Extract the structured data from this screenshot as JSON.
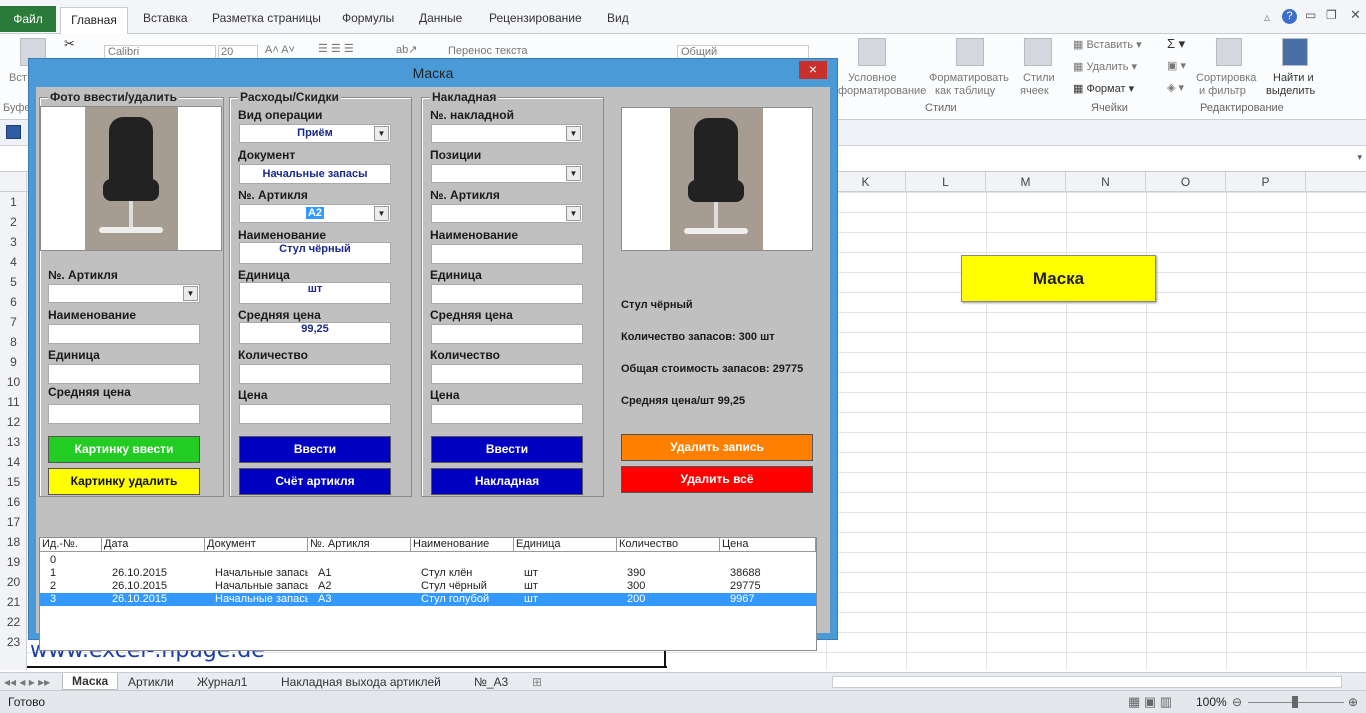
{
  "ribbon": {
    "tabs": [
      "Файл",
      "Главная",
      "Вставка",
      "Разметка страницы",
      "Формулы",
      "Данные",
      "Рецензирование",
      "Вид"
    ],
    "font_name": "Calibri",
    "font_size": "20",
    "wrap_text": "Перенос текста",
    "number_format": "Общий",
    "cond_format": [
      "Условное",
      "форматирование"
    ],
    "format_table": [
      "Форматировать",
      "как таблицу"
    ],
    "cell_styles": [
      "Стили",
      "ячеек"
    ],
    "insert": "Вставить",
    "delete": "Удалить",
    "format": "Формат",
    "sort_filter": [
      "Сортировка",
      "и фильтр"
    ],
    "find_select": [
      "Найти и",
      "выделить"
    ],
    "group_styles": "Стили",
    "group_cells": "Ячейки",
    "group_editing": "Редактирование",
    "clipboard_cut": "Вст",
    "clipboard_group": "Буфе"
  },
  "grid": {
    "columns": [
      "K",
      "L",
      "M",
      "N",
      "O",
      "P"
    ],
    "rows": [
      "1",
      "2",
      "3",
      "4",
      "5",
      "6",
      "7",
      "8",
      "9",
      "10",
      "11",
      "12",
      "13",
      "14",
      "15",
      "16",
      "17",
      "18",
      "19",
      "20",
      "21",
      "22",
      "23"
    ],
    "sheet_button": "Маска",
    "url": "www.excel-.npage.de"
  },
  "sheets": {
    "tabs": [
      "Маска",
      "Артикли",
      "Журнал1",
      "Накладная выхода артиклей",
      "№_A3"
    ],
    "status": "Готово",
    "zoom": "100%"
  },
  "dialog": {
    "title": "Маска",
    "close": "×",
    "photo_frame": {
      "caption": "Фото ввести/удалить",
      "article_label": "№. Артикля",
      "name_label": "Наименование",
      "unit_label": "Единица",
      "avg_price_label": "Средняя цена",
      "btn_add_image": "Картинку ввести",
      "btn_remove_image": "Картинку удалить"
    },
    "expense_frame": {
      "caption": "Расходы/Скидки",
      "operation_label": "Вид операции",
      "operation_value": "Приём",
      "document_label": "Документ",
      "document_value": "Начальные запасы",
      "article_label": "№. Артикля",
      "article_value": "A2",
      "name_label": "Наименование",
      "name_value": "Стул чёрный",
      "unit_label": "Единица",
      "unit_value": "шт",
      "avg_price_label": "Средняя цена",
      "avg_price_value": "99,25",
      "qty_label": "Количество",
      "price_label": "Цена",
      "btn_enter": "Ввести",
      "btn_count": "Счёт артикля"
    },
    "invoice_frame": {
      "caption": "Накладная",
      "invoice_no_label": "№. накладной",
      "positions_label": "Позиции",
      "article_label": "№. Артикля",
      "name_label": "Наименование",
      "unit_label": "Единица",
      "avg_price_label": "Средняя цена",
      "qty_label": "Количество",
      "price_label": "Цена",
      "btn_enter": "Ввести",
      "btn_invoice": "Накладная"
    },
    "info": {
      "name": "Стул чёрный",
      "stock": "Количество запасов: 300 шт",
      "total": "Общая стоимость запасов: 29775",
      "avg": "Средняя цена/шт 99,25",
      "btn_delete_record": "Удалить запись",
      "btn_delete_all": "Удалить всё"
    },
    "list": {
      "headers": [
        "Ид.-№.",
        "Дата",
        "Документ",
        "№. Артикля",
        "Наименование",
        "Единица",
        "Количество",
        "Цена"
      ],
      "rows": [
        [
          "0",
          "",
          "",
          "",
          "",
          "",
          "",
          ""
        ],
        [
          "1",
          "26.10.2015",
          "Начальные запасы",
          "A1",
          "Стул клён",
          "шт",
          "390",
          "38688"
        ],
        [
          "2",
          "26.10.2015",
          "Начальные запасы",
          "A2",
          "Стул чёрный",
          "шт",
          "300",
          "29775"
        ],
        [
          "3",
          "26.10.2015",
          "Начальные запасы",
          "A3",
          "Стул голубой",
          "шт",
          "200",
          "9967"
        ]
      ],
      "selected_row": 3
    }
  },
  "colors": {
    "dialog_bg": "#c0c0c0",
    "btn_green": "#22cc22",
    "btn_yellow": "#ffff00",
    "btn_blue": "#0000c0",
    "btn_orange": "#ff8000",
    "btn_red": "#ff0000",
    "selection": "#3399ff"
  }
}
